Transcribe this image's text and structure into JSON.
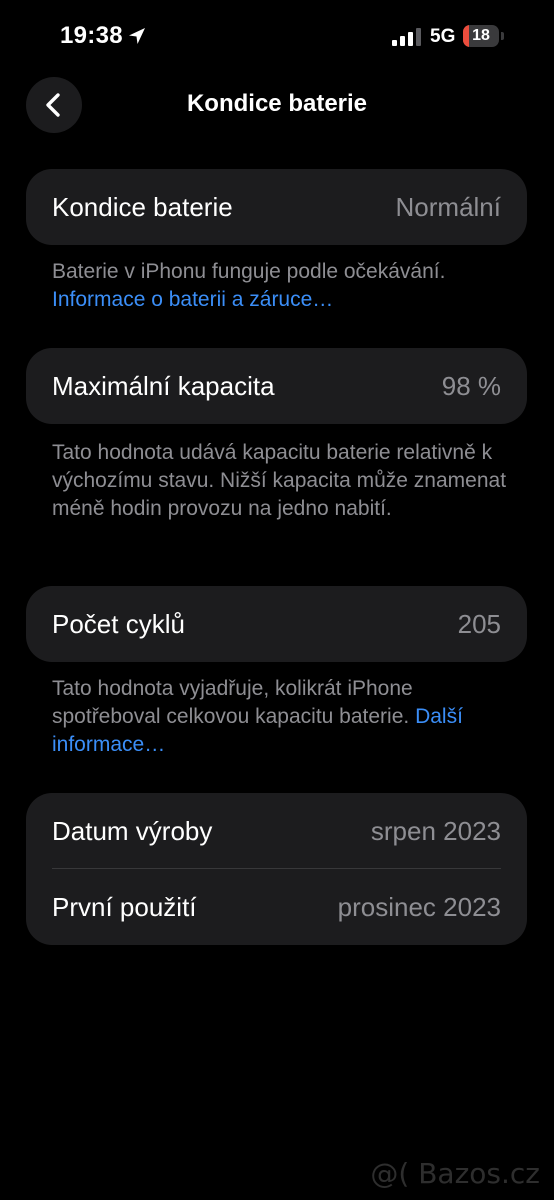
{
  "status_bar": {
    "time": "19:38",
    "network": "5G",
    "battery_level": "18",
    "battery_fraction": 0.18,
    "battery_color": "#eb4d3d"
  },
  "nav": {
    "title": "Kondice baterie",
    "back_icon": "chevron-left-icon"
  },
  "health": {
    "label": "Kondice baterie",
    "value": "Normální",
    "note_text": "Baterie v iPhonu funguje podle očekávání. ",
    "note_link": "Informace o baterii a záruce…"
  },
  "capacity": {
    "label": "Maximální kapacita",
    "value": "98 %",
    "note_text": "Tato hodnota udává kapacitu baterie relativně k výchozímu stavu. Nižší kapacita může znamenat méně hodin provozu na jedno nabití."
  },
  "cycles": {
    "label": "Počet cyklů",
    "value": "205",
    "note_text": "Tato hodnota vyjadřuje, kolikrát iPhone spotřeboval celkovou kapacitu baterie. ",
    "note_link": "Další informace…"
  },
  "dates": {
    "manufacture_label": "Datum výroby",
    "manufacture_value": "srpen 2023",
    "first_use_label": "První použití",
    "first_use_value": "prosinec 2023"
  },
  "watermark": "@( Bazos.cz",
  "colors": {
    "background": "#000000",
    "card": "#1c1c1e",
    "secondary_text": "#8e8e93",
    "link": "#3b8ef7"
  }
}
